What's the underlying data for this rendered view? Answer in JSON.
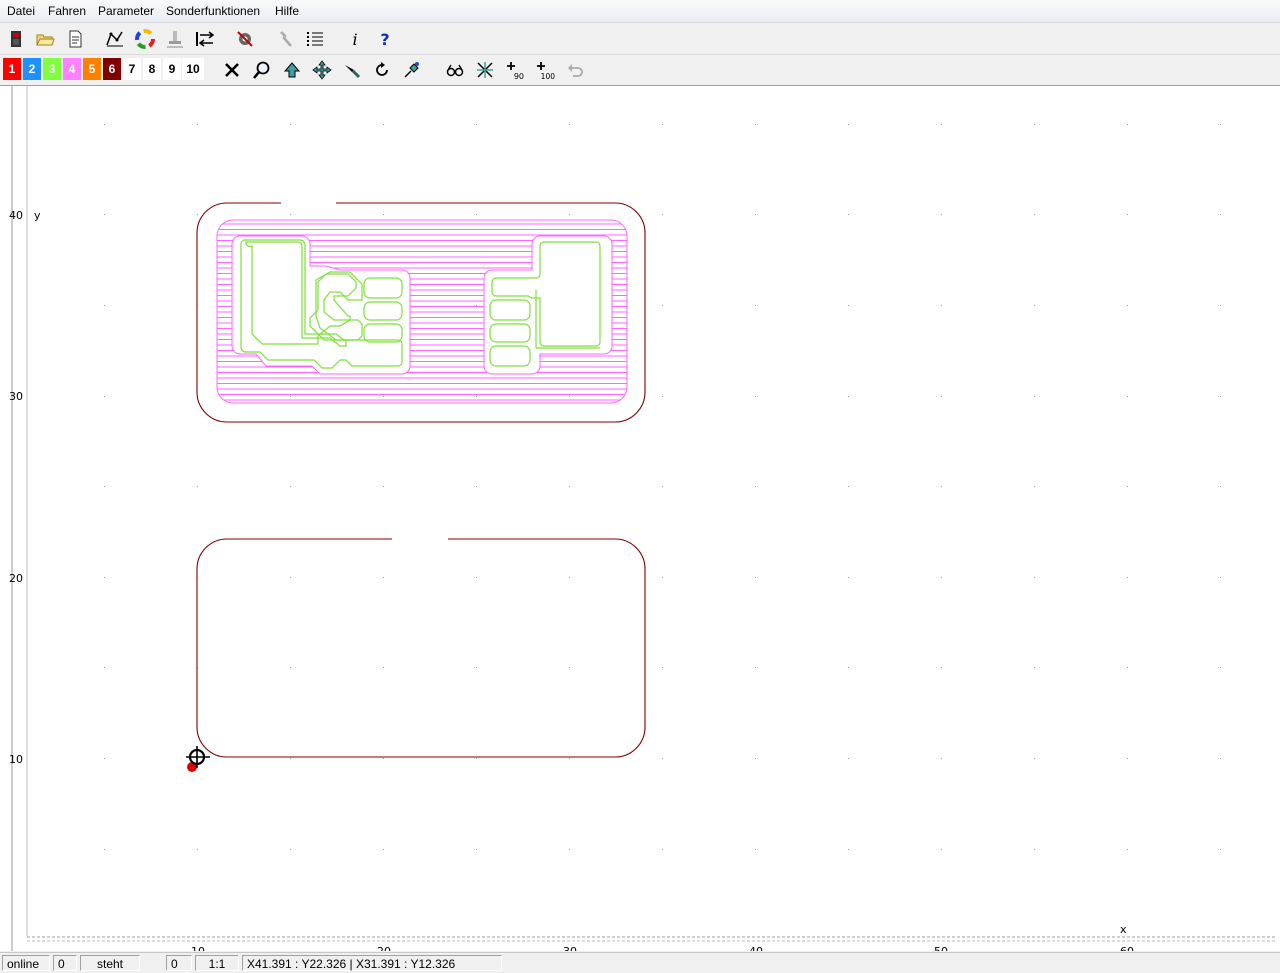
{
  "menu": [
    "Datei",
    "Fahren",
    "Parameter",
    "Sonderfunktionen",
    "Hilfe"
  ],
  "toolbar1": {
    "icons": [
      "exit-icon",
      "open-folder-icon",
      "document-icon",
      "path-icon",
      "color-wheel-icon",
      "tool-icon",
      "swap-icon",
      "settings-icon",
      "wrench-icon",
      "list-icon",
      "info-icon",
      "help-icon"
    ]
  },
  "pens": [
    {
      "label": "1",
      "color": "#ff0000"
    },
    {
      "label": "2",
      "color": "#1e90ff"
    },
    {
      "label": "3",
      "color": "#80ff40"
    },
    {
      "label": "4",
      "color": "#ff80ff"
    },
    {
      "label": "5",
      "color": "#ff8000"
    },
    {
      "label": "6",
      "color": "#800000"
    },
    {
      "label": "7",
      "color": "#ffffff"
    },
    {
      "label": "8",
      "color": "#ffffff"
    },
    {
      "label": "9",
      "color": "#ffffff"
    },
    {
      "label": "10",
      "color": "#ffffff"
    }
  ],
  "toolbar2": {
    "icons": [
      "delete-icon",
      "zoom-icon",
      "arrow-up-icon",
      "move-icon",
      "knife-icon",
      "rotate-icon",
      "pin-icon",
      "glasses-icon",
      "crosshair-icon",
      "plus-90-icon",
      "plus-100-icon",
      "undo-icon"
    ],
    "badges": {
      "plus90": "90",
      "plus100": "100"
    }
  },
  "canvas": {
    "y_axis_label": "y",
    "x_axis_label": "x",
    "y_ticks": [
      "40",
      "30",
      "20",
      "10"
    ],
    "x_ticks": [
      "10",
      "20",
      "30",
      "40",
      "50",
      "60"
    ],
    "colors": {
      "contour": "#800000",
      "hatch": "#ff66ff",
      "traces": "#80e040",
      "marker": "#ff0000"
    }
  },
  "status": {
    "connection": "online",
    "field1": "0",
    "state": "steht",
    "field2": "0",
    "scale": "1:1",
    "coords": "X41.391 : Y22.326  |  X31.391 : Y12.326"
  }
}
